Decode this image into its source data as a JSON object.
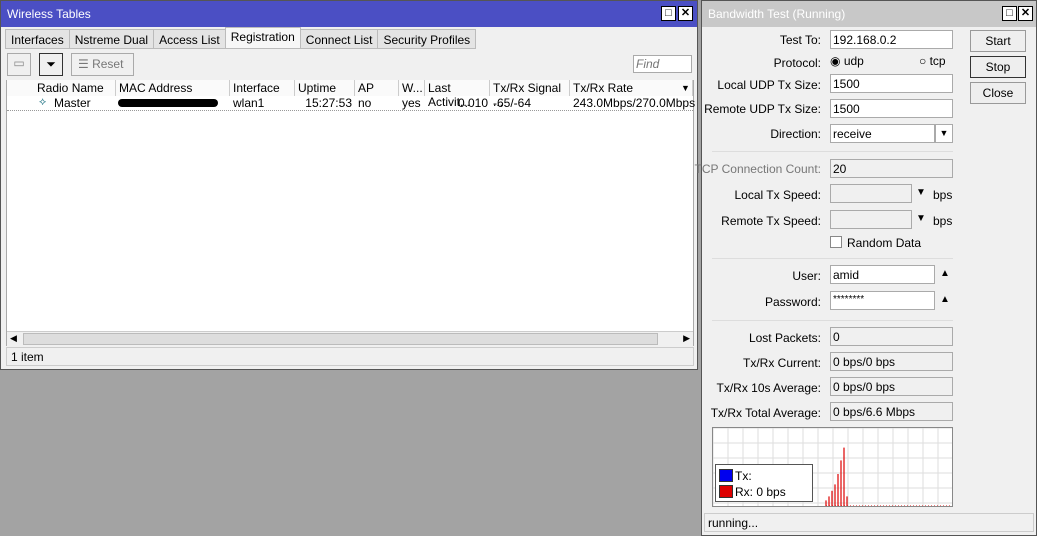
{
  "wireless": {
    "title": "Wireless Tables",
    "tabs": [
      "Interfaces",
      "Nstreme Dual",
      "Access List",
      "Registration",
      "Connect List",
      "Security Profiles"
    ],
    "active_tab": "Registration",
    "reset_label": "Reset",
    "find_placeholder": "Find",
    "columns": [
      "Radio Name",
      "MAC Address",
      "Interface",
      "Uptime",
      "AP",
      "W...",
      "Last Activit...",
      "Tx/Rx Signal ...",
      "Tx/Rx Rate"
    ],
    "rows": [
      {
        "radio_name": "Master",
        "mac": "",
        "interface": "wlan1",
        "uptime": "15:27:53",
        "ap": "no",
        "w": "yes",
        "last_activity": "0.010",
        "signal": "-65/-64",
        "rate": "243.0Mbps/270.0Mbps"
      }
    ],
    "status": "1 item"
  },
  "bandwidth": {
    "title": "Bandwidth Test (Running)",
    "test_to_label": "Test To:",
    "test_to": "192.168.0.2",
    "protocol_label": "Protocol:",
    "udp": "udp",
    "tcp": "tcp",
    "local_udp_label": "Local UDP Tx Size:",
    "local_udp": "1500",
    "remote_udp_label": "Remote UDP Tx Size:",
    "remote_udp": "1500",
    "direction_label": "Direction:",
    "direction": "receive",
    "tcp_count_label": "TCP Connection Count:",
    "tcp_count": "20",
    "local_speed_label": "Local Tx Speed:",
    "remote_speed_label": "Remote Tx Speed:",
    "bps": "bps",
    "random_label": "Random Data",
    "user_label": "User:",
    "user": "amid",
    "password_label": "Password:",
    "password": "********",
    "lost_label": "Lost Packets:",
    "lost": "0",
    "current_label": "Tx/Rx Current:",
    "current": "0 bps/0 bps",
    "avg10_label": "Tx/Rx 10s Average:",
    "avg10": "0 bps/0 bps",
    "total_label": "Tx/Rx Total Average:",
    "total": "0 bps/6.6 Mbps",
    "start": "Start",
    "stop": "Stop",
    "close": "Close",
    "legend_tx": "Tx:",
    "legend_rx": "Rx:  0 bps",
    "status": "running...",
    "colors": {
      "tx": "#0000ee",
      "rx": "#dd0000"
    },
    "rx_bars": [
      0.07,
      0.12,
      0.19,
      0.27,
      0.4,
      0.57,
      0.73,
      0.12
    ]
  }
}
